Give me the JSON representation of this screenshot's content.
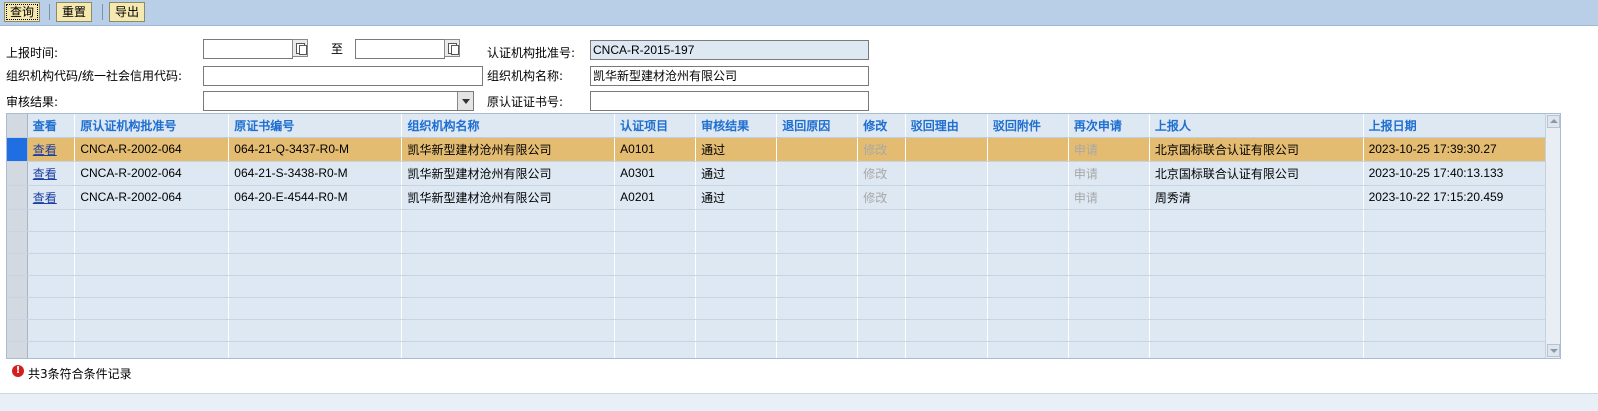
{
  "toolbar": {
    "query_label": "查询",
    "reset_label": "重置",
    "export_label": "导出"
  },
  "form": {
    "report_time_label": "上报时间:",
    "to_label": "至",
    "report_time_from": "",
    "report_time_to": "",
    "cert_body_approval_label": "认证机构批准号:",
    "cert_body_approval_value": "CNCA-R-2015-197",
    "org_code_label": "组织机构代码/统一社会信用代码:",
    "org_code_value": "",
    "org_name_label": "组织机构名称:",
    "org_name_value": "凯华新型建材沧州有限公司",
    "review_result_label": "审核结果:",
    "review_result_value": "",
    "orig_cert_no_label": "原认证证书号:",
    "orig_cert_no_value": ""
  },
  "table": {
    "columns": [
      "查看",
      "原认证机构批准号",
      "原证书编号",
      "组织机构名称",
      "认证项目",
      "审核结果",
      "退回原因",
      "修改",
      "驳回理由",
      "驳回附件",
      "再次申请",
      "上报人",
      "上报日期"
    ],
    "rows": [
      {
        "view": "查看",
        "orig_approval": "CNCA-R-2002-064",
        "orig_cert": "064-21-Q-3437-R0-M",
        "org": "凯华新型建材沧州有限公司",
        "project": "A0101",
        "result": "通过",
        "return_reason": "",
        "modify": "修改",
        "reject_reason": "",
        "reject_attach": "",
        "reapply": "申请",
        "reporter": "北京国标联合认证有限公司",
        "date": "2023-10-25 17:39:30.27"
      },
      {
        "view": "查看",
        "orig_approval": "CNCA-R-2002-064",
        "orig_cert": "064-21-S-3438-R0-M",
        "org": "凯华新型建材沧州有限公司",
        "project": "A0301",
        "result": "通过",
        "return_reason": "",
        "modify": "修改",
        "reject_reason": "",
        "reject_attach": "",
        "reapply": "申请",
        "reporter": "北京国标联合认证有限公司",
        "date": "2023-10-25 17:40:13.133"
      },
      {
        "view": "查看",
        "orig_approval": "CNCA-R-2002-064",
        "orig_cert": "064-20-E-4544-R0-M",
        "org": "凯华新型建材沧州有限公司",
        "project": "A0201",
        "result": "通过",
        "return_reason": "",
        "modify": "修改",
        "reject_reason": "",
        "reject_attach": "",
        "reapply": "申请",
        "reporter": "周秀清",
        "date": "2023-10-22 17:15:20.459"
      }
    ],
    "selected_row": 0
  },
  "status": {
    "record_count_text": "共3条符合条件记录"
  },
  "colors": {
    "toolbar_bg": "#b8cfe7",
    "header_text": "#1f6fd1",
    "selected_row": "#e3bc72",
    "grid_bg": "#dde8f3"
  }
}
